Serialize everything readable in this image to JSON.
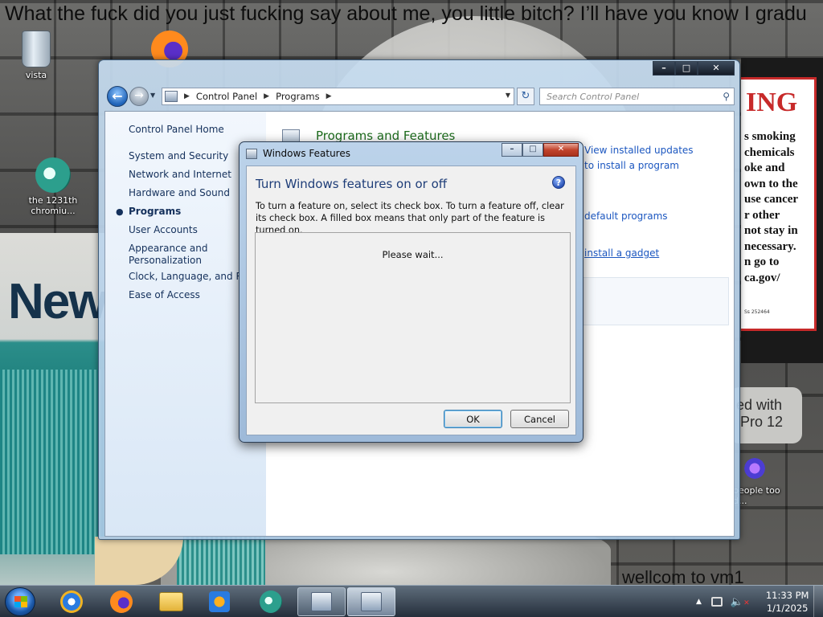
{
  "desktop": {
    "banner_text": "What the fuck did you just fucking say about me, you little bitch? I’ll have you know I gradu",
    "warning": {
      "title": "ING",
      "body": "s smoking\nchemicals\noke and\nown to the\nuse cancer\nr other\nnot stay in\nnecessary.\nn go to\nca.gov/",
      "code": "Ss 252464"
    },
    "box_text": "Newp",
    "pro_badge": "ed with\n Pro 12",
    "wallcome_text": "wellcom to vm1",
    "icons": [
      {
        "label": "vista",
        "icon": "recycle-bin-icon"
      },
      {
        "label": "",
        "icon": "firefox-icon"
      },
      {
        "label": "the 1231th chromiu...",
        "icon": "chromium-icon"
      },
      {
        "label": "people too d...",
        "icon": "app-icon"
      }
    ]
  },
  "explorer": {
    "breadcrumb": [
      "Control Panel",
      "Programs"
    ],
    "search_placeholder": "Search Control Panel",
    "left_pane": {
      "home": "Control Panel Home",
      "categories": [
        {
          "label": "System and Security",
          "active": false
        },
        {
          "label": "Network and Internet",
          "active": false
        },
        {
          "label": "Hardware and Sound",
          "active": false
        },
        {
          "label": "Programs",
          "active": true
        },
        {
          "label": "User Accounts",
          "active": false
        },
        {
          "label": "Appearance and Personalization",
          "active": false
        },
        {
          "label": "Clock, Language, and Regi",
          "active": false
        },
        {
          "label": "Ease of Access",
          "active": false
        }
      ]
    },
    "main": {
      "section_title": "Programs and Features",
      "links": {
        "view_installed_updates": "View installed updates",
        "install_program": "to install a program",
        "default_programs": "default programs",
        "install_gadget": "install a gadget"
      }
    }
  },
  "dialog": {
    "title": "Windows Features",
    "heading": "Turn Windows features on or off",
    "description": "To turn a feature on, select its check box. To turn a feature off, clear its check box. A filled box means that only part of the feature is turned on.",
    "status": "Please wait...",
    "ok_label": "OK",
    "cancel_label": "Cancel"
  },
  "taskbar": {
    "pinned": [
      "internet-explorer-icon",
      "firefox-icon",
      "file-explorer-icon",
      "media-player-icon",
      "chromium-icon"
    ],
    "time": "11:33 PM",
    "date": "1/1/2025"
  }
}
